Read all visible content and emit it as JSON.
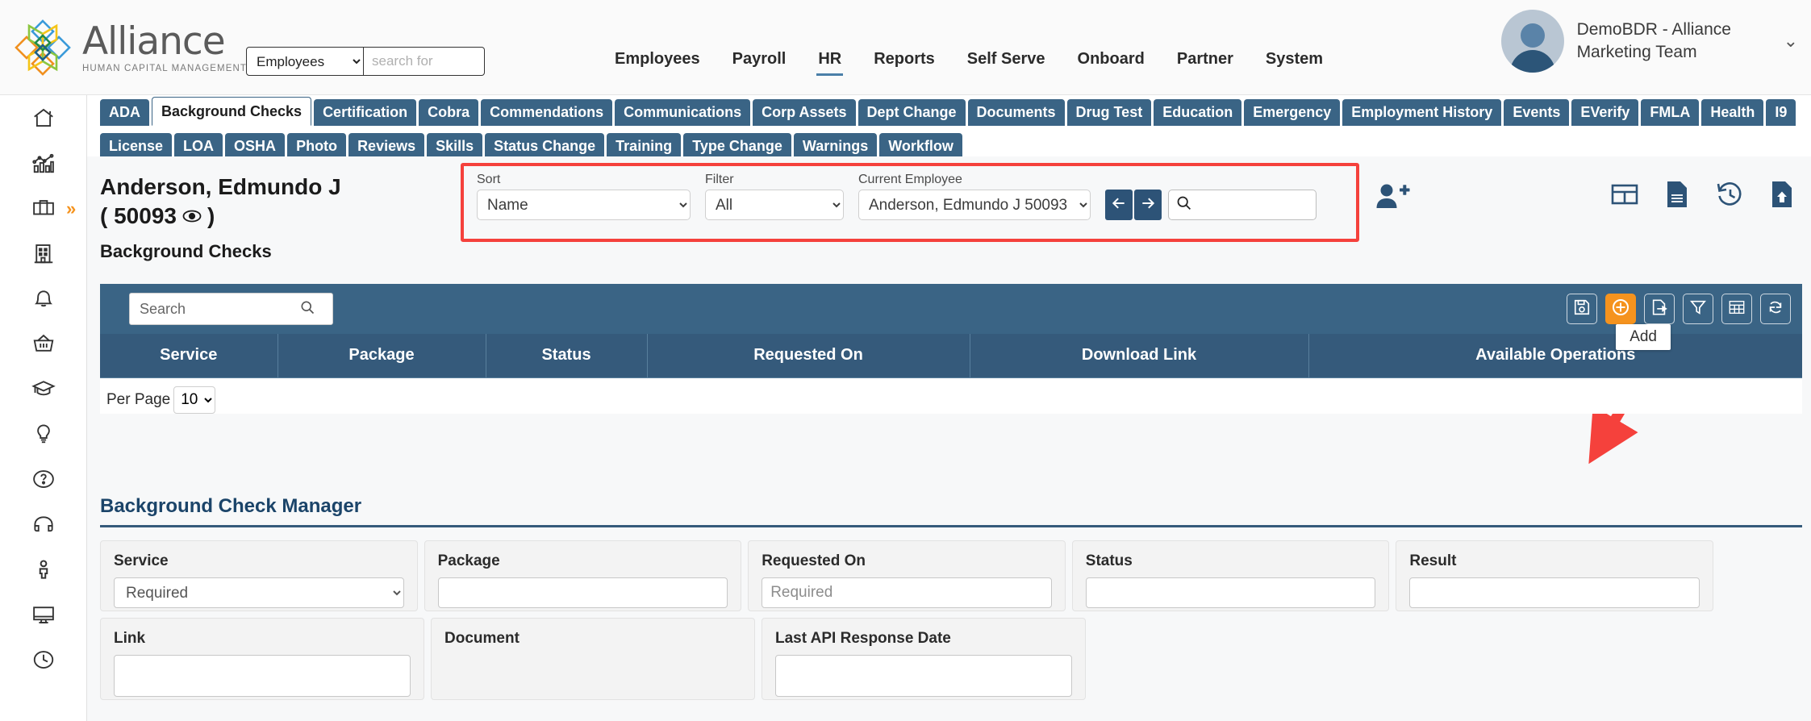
{
  "brand": {
    "name": "Alliance",
    "tagline": "HUMAN CAPITAL MANAGEMENT"
  },
  "global_search": {
    "scope_value": "Employees",
    "placeholder": "search for",
    "value": ""
  },
  "main_nav": [
    {
      "label": "Employees",
      "active": false
    },
    {
      "label": "Payroll",
      "active": false
    },
    {
      "label": "HR",
      "active": true
    },
    {
      "label": "Reports",
      "active": false
    },
    {
      "label": "Self Serve",
      "active": false
    },
    {
      "label": "Onboard",
      "active": false
    },
    {
      "label": "Partner",
      "active": false
    },
    {
      "label": "System",
      "active": false
    }
  ],
  "user": {
    "name": "DemoBDR - Alliance Marketing Team"
  },
  "sidebar": {
    "expander": "»",
    "items": [
      {
        "icon": "home-icon"
      },
      {
        "icon": "analytics-icon"
      },
      {
        "icon": "briefcase-icon"
      },
      {
        "icon": "building-icon"
      },
      {
        "icon": "bell-icon"
      },
      {
        "icon": "basket-icon"
      },
      {
        "icon": "graduation-cap-icon"
      },
      {
        "icon": "lightbulb-icon"
      },
      {
        "icon": "question-circle-icon"
      },
      {
        "icon": "headset-icon"
      },
      {
        "icon": "person-icon"
      },
      {
        "icon": "monitor-icon"
      },
      {
        "icon": "clock-icon"
      }
    ]
  },
  "tabs_row1": [
    {
      "label": "ADA",
      "active": false
    },
    {
      "label": "Background Checks",
      "active": true
    },
    {
      "label": "Certification",
      "active": false
    },
    {
      "label": "Cobra",
      "active": false
    },
    {
      "label": "Commendations",
      "active": false
    },
    {
      "label": "Communications",
      "active": false
    },
    {
      "label": "Corp Assets",
      "active": false
    },
    {
      "label": "Dept Change",
      "active": false
    },
    {
      "label": "Documents",
      "active": false
    },
    {
      "label": "Drug Test",
      "active": false
    },
    {
      "label": "Education",
      "active": false
    },
    {
      "label": "Emergency",
      "active": false
    },
    {
      "label": "Employment History",
      "active": false
    },
    {
      "label": "Events",
      "active": false
    },
    {
      "label": "EVerify",
      "active": false
    },
    {
      "label": "FMLA",
      "active": false
    },
    {
      "label": "Health",
      "active": false
    },
    {
      "label": "I9",
      "active": false
    }
  ],
  "tabs_row2": [
    {
      "label": "License",
      "active": false
    },
    {
      "label": "LOA",
      "active": false
    },
    {
      "label": "OSHA",
      "active": false
    },
    {
      "label": "Photo",
      "active": false
    },
    {
      "label": "Reviews",
      "active": false
    },
    {
      "label": "Skills",
      "active": false
    },
    {
      "label": "Status Change",
      "active": false
    },
    {
      "label": "Training",
      "active": false
    },
    {
      "label": "Type Change",
      "active": false
    },
    {
      "label": "Warnings",
      "active": false
    },
    {
      "label": "Workflow",
      "active": false
    }
  ],
  "employee": {
    "name": "Anderson, Edmundo J",
    "id_line": "( 50093",
    "id_close": ")",
    "section": "Background Checks"
  },
  "controls": {
    "sort_label": "Sort",
    "sort_value": "Name",
    "filter_label": "Filter",
    "filter_value": "All",
    "current_employee_label": "Current Employee",
    "current_employee_value": "Anderson, Edmundo J 50093",
    "search_value": "",
    "prev_icon": "arrow-left-icon",
    "next_icon": "arrow-right-icon"
  },
  "header_icons": [
    {
      "name": "add-employee-icon"
    },
    {
      "name": "table-view-icon"
    },
    {
      "name": "document-icon"
    },
    {
      "name": "history-icon"
    },
    {
      "name": "upload-document-icon"
    }
  ],
  "grid": {
    "search_placeholder": "Search",
    "search_value": "",
    "tooltip": "Add",
    "toolbar": [
      {
        "name": "save-icon",
        "accent": false
      },
      {
        "name": "add-icon",
        "accent": true
      },
      {
        "name": "export-icon",
        "accent": false
      },
      {
        "name": "filter-icon",
        "accent": false
      },
      {
        "name": "grid-icon",
        "accent": false
      },
      {
        "name": "refresh-icon",
        "accent": false
      }
    ],
    "columns": [
      "Service",
      "Package",
      "Status",
      "Requested On",
      "Download Link",
      "Available Operations"
    ],
    "rows": [],
    "per_page_label": "Per Page",
    "per_page_value": "10"
  },
  "manager": {
    "title": "Background Check Manager",
    "fields_row1": [
      {
        "label": "Service",
        "type": "select",
        "value": "Required",
        "placeholder": "Required"
      },
      {
        "label": "Package",
        "type": "input",
        "value": "",
        "placeholder": ""
      },
      {
        "label": "Requested On",
        "type": "input",
        "value": "",
        "placeholder": "Required"
      },
      {
        "label": "Status",
        "type": "input",
        "value": "",
        "placeholder": ""
      },
      {
        "label": "Result",
        "type": "input",
        "value": "",
        "placeholder": ""
      }
    ],
    "fields_row2": [
      {
        "label": "Link",
        "type": "input",
        "value": "",
        "placeholder": ""
      },
      {
        "label": "Document",
        "type": "none",
        "value": "",
        "placeholder": ""
      },
      {
        "label": "Last API Response Date",
        "type": "input",
        "value": "",
        "placeholder": ""
      }
    ]
  },
  "colors": {
    "nav_blue": "#3a6485",
    "header_blue": "#355a7b",
    "accent_orange": "#f5931e",
    "annotation_red": "#f5413c",
    "title_blue": "#1b4469"
  }
}
